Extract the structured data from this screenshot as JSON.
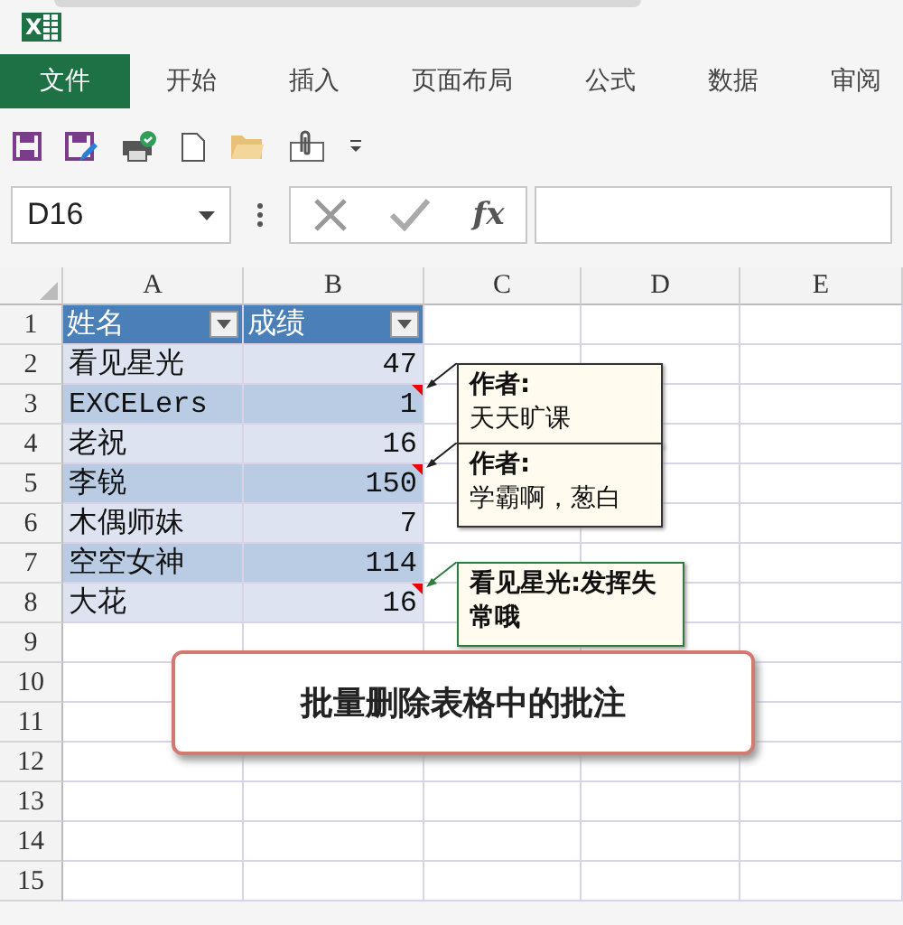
{
  "app": {
    "logo": "X"
  },
  "ribbon_tabs": [
    {
      "label": "文件",
      "selected": true
    },
    {
      "label": "开始",
      "selected": false
    },
    {
      "label": "插入",
      "selected": false
    },
    {
      "label": "页面布局",
      "selected": false
    },
    {
      "label": "公式",
      "selected": false
    },
    {
      "label": "数据",
      "selected": false
    },
    {
      "label": "审阅",
      "selected": false
    }
  ],
  "quick_access": [
    {
      "kind": "save"
    },
    {
      "kind": "save-as"
    },
    {
      "kind": "print"
    },
    {
      "kind": "new"
    },
    {
      "kind": "open"
    },
    {
      "kind": "attach"
    },
    {
      "kind": "more"
    }
  ],
  "formula_bar": {
    "name_box": "D16",
    "fx": "fx"
  },
  "columns": [
    "A",
    "B",
    "C",
    "D",
    "E"
  ],
  "rows": [
    {
      "number": "1",
      "header": true,
      "cells": [
        "姓名",
        "成绩"
      ]
    },
    {
      "number": "2",
      "cells": [
        "看见星光",
        "47"
      ]
    },
    {
      "number": "3",
      "cells": [
        "EXCELers",
        "1"
      ],
      "comment": {
        "kind": "author",
        "author": "作者:",
        "text": "天天旷课",
        "selected": false
      }
    },
    {
      "number": "4",
      "cells": [
        "老祝",
        "16"
      ]
    },
    {
      "number": "5",
      "cells": [
        "李锐",
        "150"
      ],
      "comment": {
        "kind": "author",
        "author": "作者:",
        "text": "学霸啊，葱白",
        "selected": false
      }
    },
    {
      "number": "6",
      "cells": [
        "木偶师妹",
        "7"
      ]
    },
    {
      "number": "7",
      "cells": [
        "空空女神",
        "114"
      ]
    },
    {
      "number": "8",
      "cells": [
        "大花",
        "16"
      ],
      "comment": {
        "kind": "plain",
        "text": "看见星光:发挥失常哦",
        "selected": true
      }
    },
    {
      "number": "9",
      "cells": []
    },
    {
      "number": "10",
      "cells": []
    },
    {
      "number": "11",
      "cells": []
    },
    {
      "number": "12",
      "cells": []
    },
    {
      "number": "13",
      "cells": []
    },
    {
      "number": "14",
      "cells": []
    },
    {
      "number": "15",
      "cells": []
    }
  ],
  "banner": "批量删除表格中的批注"
}
